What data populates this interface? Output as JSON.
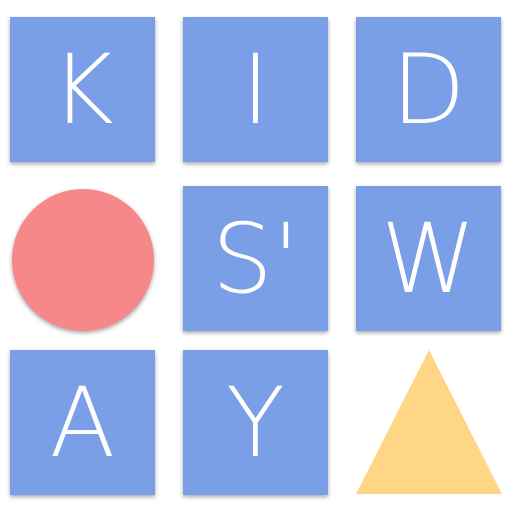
{
  "logo": {
    "tiles": [
      {
        "id": "k",
        "letter": "K"
      },
      {
        "id": "i",
        "letter": "I"
      },
      {
        "id": "d",
        "letter": "D"
      },
      {
        "id": "s-apostrophe",
        "letter": "S'"
      },
      {
        "id": "w",
        "letter": "W"
      },
      {
        "id": "a",
        "letter": "A"
      },
      {
        "id": "y",
        "letter": "Y"
      }
    ],
    "colors": {
      "tile": "#7b9fe6",
      "letter": "#ffffff",
      "circle": "#f6888a",
      "triangle": "#fed685"
    },
    "shapes": [
      "circle",
      "triangle"
    ]
  }
}
